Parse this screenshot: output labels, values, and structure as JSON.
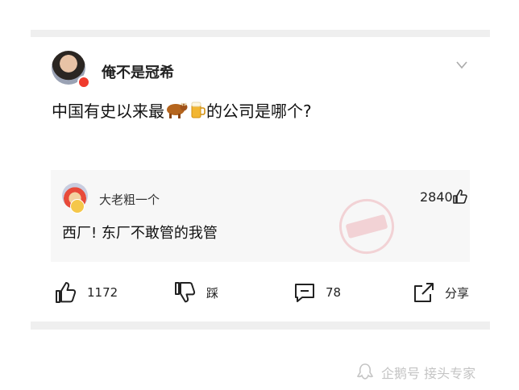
{
  "post": {
    "author": "俺不是冠希",
    "text_before": "中国有史以来最",
    "text_after": "的公司是哪个?"
  },
  "comment": {
    "author": "大老粗一个",
    "likes": "2840",
    "text": "西厂! 东厂不敢管的我管"
  },
  "actions": {
    "like_count": "1172",
    "dislike_label": "踩",
    "comment_count": "78",
    "share_label": "分享"
  },
  "watermark": {
    "text": "企鹅号 接头专家"
  },
  "icons": {
    "post_emojis": [
      "cow-icon",
      "beer-icon"
    ],
    "comment_like": "thumbs-up-icon",
    "stamp": "shenping-stamp-icon"
  },
  "colors": {
    "band": "#efefef",
    "comment_bg": "#f7f7f7",
    "stamp": "#e88c96",
    "avatar_badge": "#ef3b2d"
  }
}
